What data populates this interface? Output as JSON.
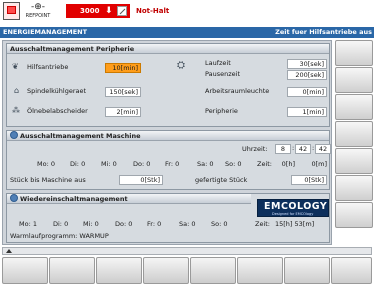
{
  "status": {
    "refpoint_label": "REFPOINT",
    "spindle_value": "3000",
    "mode_text": "Not-Halt"
  },
  "header": {
    "title": "ENERGIEMANAGEMENT",
    "right_text": "Zeit fuer Hilfsantriebe aus"
  },
  "peripherie": {
    "title": "Ausschaltmanagement Peripherie",
    "hilfsantriebe": {
      "label": "Hilfsantriebe",
      "value": "10[min]"
    },
    "spindelkuehlgeraet": {
      "label": "Spindelkühlgeraet",
      "value": "150[sek]"
    },
    "oelnebelabscheider": {
      "label": "Ölnebelabscheider",
      "value": "2[min]"
    },
    "laufzeit": {
      "label": "Laufzeit",
      "value": "30[sek]"
    },
    "pausenzeit": {
      "label": "Pausenzeit",
      "value": "200[sek]"
    },
    "arbeitsraumleuchte": {
      "label": "Arbeitsraumleuchte",
      "value": "0[min]"
    },
    "peripherie": {
      "label": "Peripherie",
      "value": "1[min]"
    }
  },
  "maschine": {
    "title": "Ausschaltmanagement Maschine",
    "uhrzeit_label": "Uhrzeit:",
    "uhrzeit": [
      "8",
      "42",
      "42"
    ],
    "days": [
      "Mo: 0",
      "Di: 0",
      "Mi: 0",
      "Do: 0",
      "Fr: 0",
      "Sa: 0",
      "So: 0"
    ],
    "zeit_label": "Zeit:",
    "zeit_h": "0[h]",
    "zeit_m": "0[m]",
    "stueck_label": "Stück bis Maschine aus",
    "stueck_value": "0[Stk]",
    "gefertigt_label": "gefertigte Stück",
    "gefertigt_value": "0[Stk]"
  },
  "wiederein": {
    "title": "Wiedereinschaltmanagement",
    "logo_text": "EMCOLOGY",
    "logo_sub": "Designed for EMCOlogy",
    "days": [
      "Mo: 1",
      "Di: 0",
      "Mi: 0",
      "Do: 0",
      "Fr: 0",
      "Sa: 0",
      "So: 0"
    ],
    "zeit_label": "Zeit:",
    "zeit_value": "15[h] 53[m]",
    "warmup_label": "Warmlaufprogramm: WARMUP"
  },
  "icons": {
    "logo": "machine-status-icon",
    "refpoint": "refpoint-icon",
    "override": "feed-override-icon",
    "fan": "fan-icon",
    "coolant": "coolant-icon",
    "mist": "mist-icon",
    "lamp": "lamp-icon",
    "clock": "clock-icon",
    "scroll": "scroll-up-icon"
  },
  "colors": {
    "header_bg": "#2a67a7",
    "alarm_red": "#e10000",
    "highlight": "#ff9d1a"
  }
}
